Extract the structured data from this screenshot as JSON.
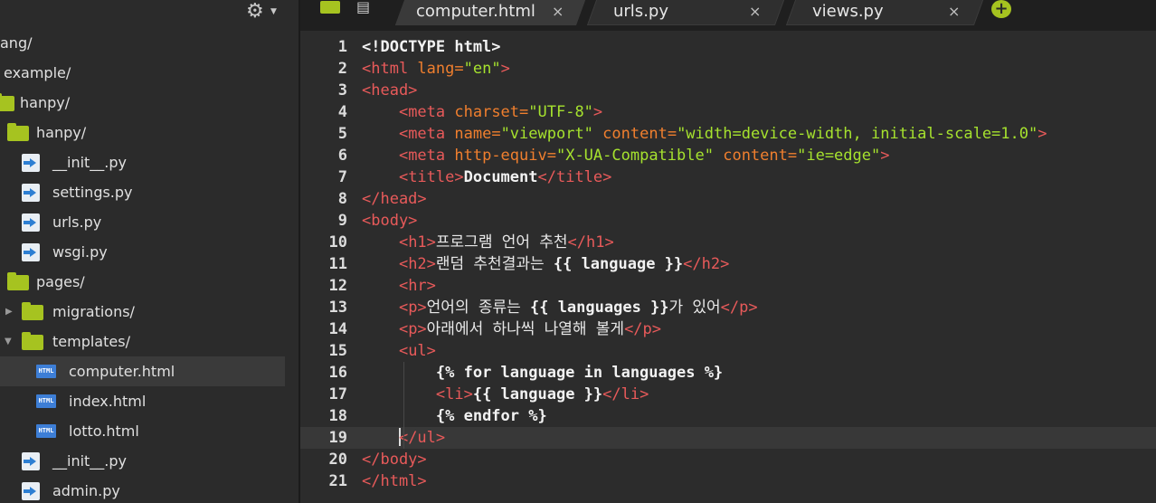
{
  "sidebar": {
    "settings_icon": "gear-icon",
    "items": [
      {
        "label": "ang/",
        "type": "folder-partial"
      },
      {
        "label": "example/",
        "type": "folder-partial"
      },
      {
        "label": "hanpy/",
        "type": "folder"
      },
      {
        "label": "hanpy/",
        "type": "folder"
      },
      {
        "label": "__init__.py",
        "type": "py"
      },
      {
        "label": "settings.py",
        "type": "py"
      },
      {
        "label": "urls.py",
        "type": "py"
      },
      {
        "label": "wsgi.py",
        "type": "py"
      },
      {
        "label": "pages/",
        "type": "folder"
      },
      {
        "label": "migrations/",
        "type": "folder",
        "arrow": "▶"
      },
      {
        "label": "templates/",
        "type": "folder",
        "arrow": "▼"
      },
      {
        "label": "computer.html",
        "type": "html",
        "selected": true
      },
      {
        "label": "index.html",
        "type": "html"
      },
      {
        "label": "lotto.html",
        "type": "html"
      },
      {
        "label": "__init__.py",
        "type": "py"
      },
      {
        "label": "admin.py",
        "type": "py"
      }
    ]
  },
  "tabs": [
    {
      "label": "computer.html",
      "active": true,
      "close": "×"
    },
    {
      "label": "urls.py",
      "active": false,
      "close": "×"
    },
    {
      "label": "views.py",
      "active": false,
      "close": "×"
    }
  ],
  "add_tab": "+",
  "editor": {
    "active_line": 19,
    "line_numbers": [
      "1",
      "2",
      "3",
      "4",
      "5",
      "6",
      "7",
      "8",
      "9",
      "10",
      "11",
      "12",
      "13",
      "14",
      "15",
      "16",
      "17",
      "18",
      "19",
      "20",
      "21"
    ],
    "lines": [
      [
        [
          "tx",
          "<!DOCTYPE html>"
        ]
      ],
      [
        [
          "tg",
          "<html "
        ],
        [
          "at",
          "lang="
        ],
        [
          "st",
          "\"en\""
        ],
        [
          "tg",
          ">"
        ]
      ],
      [
        [
          "tg",
          "<head>"
        ]
      ],
      [
        [
          "ko",
          "    "
        ],
        [
          "tg",
          "<meta "
        ],
        [
          "at",
          "charset="
        ],
        [
          "st",
          "\"UTF-8\""
        ],
        [
          "tg",
          ">"
        ]
      ],
      [
        [
          "ko",
          "    "
        ],
        [
          "tg",
          "<meta "
        ],
        [
          "at",
          "name="
        ],
        [
          "st",
          "\"viewport\""
        ],
        [
          "ko",
          " "
        ],
        [
          "at",
          "content="
        ],
        [
          "st",
          "\"width=device-width, initial-scale=1.0\""
        ],
        [
          "tg",
          ">"
        ]
      ],
      [
        [
          "ko",
          "    "
        ],
        [
          "tg",
          "<meta "
        ],
        [
          "at",
          "http-equiv="
        ],
        [
          "st",
          "\"X-UA-Compatible\""
        ],
        [
          "ko",
          " "
        ],
        [
          "at",
          "content="
        ],
        [
          "st",
          "\"ie=edge\""
        ],
        [
          "tg",
          ">"
        ]
      ],
      [
        [
          "ko",
          "    "
        ],
        [
          "tg",
          "<title>"
        ],
        [
          "tx",
          "Document"
        ],
        [
          "tg",
          "</title>"
        ]
      ],
      [
        [
          "tg",
          "</head>"
        ]
      ],
      [
        [
          "tg",
          "<body>"
        ]
      ],
      [
        [
          "ko",
          "    "
        ],
        [
          "tg",
          "<h1>"
        ],
        [
          "ko",
          "프로그램 언어 추천"
        ],
        [
          "tg",
          "</h1>"
        ]
      ],
      [
        [
          "ko",
          "    "
        ],
        [
          "tg",
          "<h2>"
        ],
        [
          "ko",
          "랜덤 추천결과는 "
        ],
        [
          "tx",
          "{{ language }}"
        ],
        [
          "tg",
          "</h2>"
        ]
      ],
      [
        [
          "ko",
          "    "
        ],
        [
          "tg",
          "<hr>"
        ]
      ],
      [
        [
          "ko",
          "    "
        ],
        [
          "tg",
          "<p>"
        ],
        [
          "ko",
          "언어의 종류는 "
        ],
        [
          "tx",
          "{{ languages }}"
        ],
        [
          "ko",
          "가 있어"
        ],
        [
          "tg",
          "</p>"
        ]
      ],
      [
        [
          "ko",
          "    "
        ],
        [
          "tg",
          "<p>"
        ],
        [
          "ko",
          "아래에서 하나씩 나열해 볼게"
        ],
        [
          "tg",
          "</p>"
        ]
      ],
      [
        [
          "ko",
          "    "
        ],
        [
          "tg",
          "<ul>"
        ]
      ],
      [
        [
          "ko",
          "        "
        ],
        [
          "tx",
          "{% for language in languages %}"
        ]
      ],
      [
        [
          "ko",
          "        "
        ],
        [
          "tg",
          "<li>"
        ],
        [
          "tx",
          "{{ language }}"
        ],
        [
          "tg",
          "</li>"
        ]
      ],
      [
        [
          "ko",
          "        "
        ],
        [
          "tx",
          "{% endfor %}"
        ]
      ],
      [
        [
          "ko",
          "    "
        ],
        [
          "cursor",
          ""
        ],
        [
          "tg",
          "</ul>"
        ]
      ],
      [
        [
          "tg",
          "</body>"
        ]
      ],
      [
        [
          "tg",
          "</html>"
        ]
      ]
    ]
  }
}
